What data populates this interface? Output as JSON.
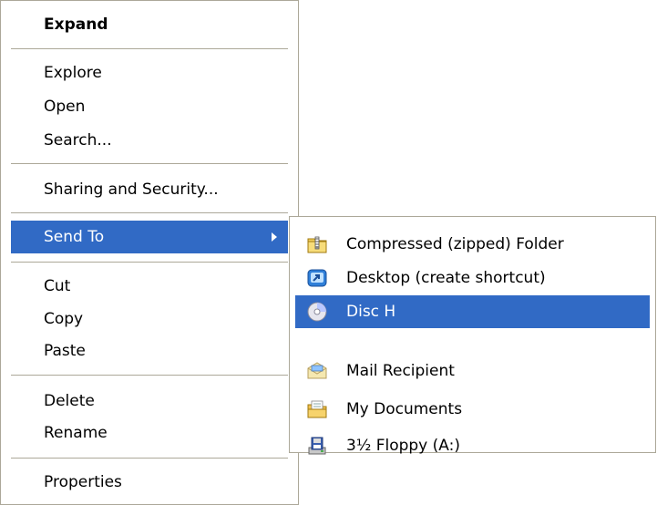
{
  "context_menu": {
    "items": [
      {
        "label": "Expand",
        "bold": true
      },
      {
        "label": "Explore"
      },
      {
        "label": "Open"
      },
      {
        "label": "Search..."
      },
      {
        "label": "Sharing and Security..."
      },
      {
        "label": "Send To",
        "selected": true,
        "has_submenu": true
      },
      {
        "label": "Cut"
      },
      {
        "label": "Copy"
      },
      {
        "label": "Paste"
      },
      {
        "label": "Delete"
      },
      {
        "label": "Rename"
      },
      {
        "label": "Properties"
      }
    ]
  },
  "send_to_menu": {
    "items": [
      {
        "label": "Compressed (zipped) Folder",
        "icon": "zipped-folder-icon"
      },
      {
        "label": "Desktop (create shortcut)",
        "icon": "desktop-shortcut-icon"
      },
      {
        "label": "Disc H",
        "icon": "cd-disc-icon",
        "selected": true
      },
      {
        "label": "Mail Recipient",
        "icon": "mail-recipient-icon"
      },
      {
        "label": "My Documents",
        "icon": "my-documents-icon"
      },
      {
        "label": "3½ Floppy (A:)",
        "icon": "floppy-drive-icon"
      }
    ]
  },
  "colors": {
    "selection": "#316ac5",
    "border": "#aca899",
    "background": "#ffffff"
  }
}
